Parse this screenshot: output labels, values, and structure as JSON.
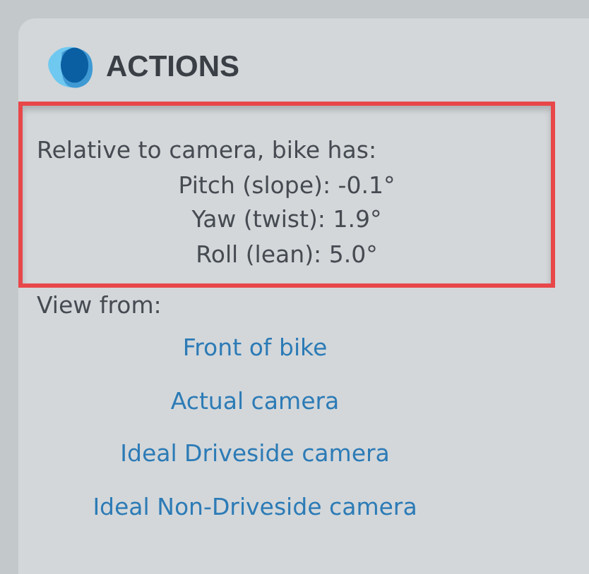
{
  "panel": {
    "title": "ACTIONS"
  },
  "orientation": {
    "heading": "Relative to camera, bike has:",
    "lines": [
      "Pitch (slope): -0.1°",
      "Yaw (twist): 1.9°",
      "Roll (lean): 5.0°"
    ]
  },
  "view": {
    "label": "View from:",
    "links": [
      "Front of bike",
      "Actual camera",
      "Ideal Driveside camera",
      "Ideal Non-Driveside camera"
    ]
  }
}
